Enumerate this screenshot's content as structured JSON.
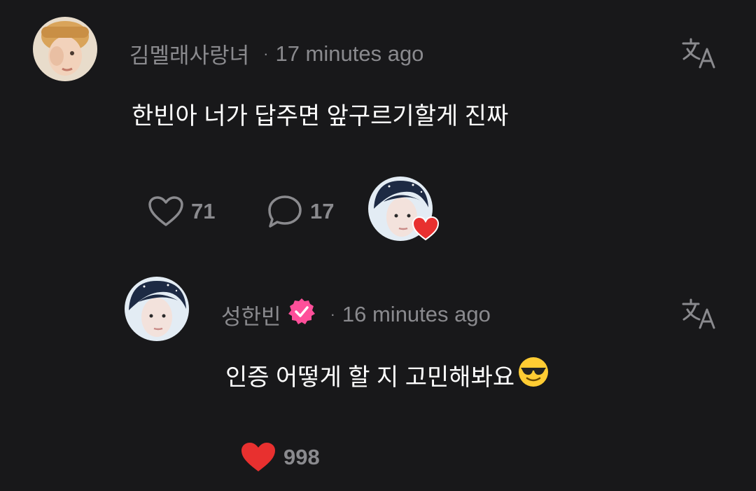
{
  "comment": {
    "username": "김멜래사랑녀",
    "separator": "·",
    "time": "17 minutes ago",
    "text": "한빈아 너가 답주면 앞구르기할게 진짜",
    "likes": "71",
    "replies": "17",
    "icons": {
      "avatar": "user-avatar-icon",
      "translate": "translate-icon",
      "like": "heart-outline-icon",
      "reply": "speech-bubble-icon",
      "creator_heart": "creator-liked-avatar-icon"
    }
  },
  "reply": {
    "username": "성한빈",
    "verified": true,
    "separator": "·",
    "time": "16 minutes ago",
    "text": "인증 어떻게 할 지 고민해봐요",
    "emoji": "smiling-face-with-sunglasses",
    "likes": "998",
    "liked": true,
    "icons": {
      "avatar": "creator-avatar-icon",
      "verified": "verified-badge-icon",
      "translate": "translate-icon",
      "like": "heart-filled-icon"
    }
  },
  "colors": {
    "background": "#18181a",
    "meta_text": "#8a8a8e",
    "body_text": "#ffffff",
    "like_red": "#e8302f",
    "verified_pink": "#ff4f9a"
  }
}
